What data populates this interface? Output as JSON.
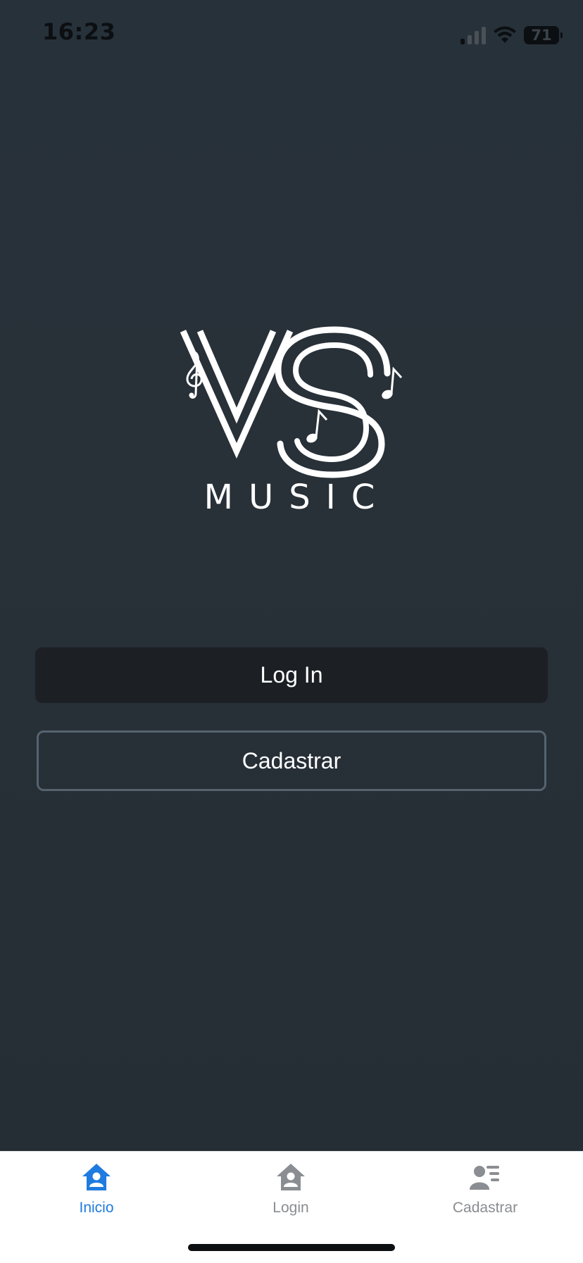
{
  "status_bar": {
    "time": "16:23",
    "battery": "71",
    "icons": [
      "cellular-signal-icon",
      "wifi-icon",
      "battery-icon"
    ]
  },
  "logo": {
    "monogram": "VS",
    "wordmark": "MUSIC"
  },
  "buttons": {
    "login_label": "Log In",
    "register_label": "Cadastrar"
  },
  "tabbar": {
    "tabs": [
      {
        "label": "Inicio",
        "icon": "home-person-icon",
        "active": true
      },
      {
        "label": "Login",
        "icon": "home-person-icon",
        "active": false
      },
      {
        "label": "Cadastrar",
        "icon": "contact-list-icon",
        "active": false
      }
    ]
  },
  "colors": {
    "background": "#262f36",
    "login_button": "#1c2025",
    "register_border": "#55636f",
    "tab_active": "#1f7be0",
    "tab_inactive": "#8a8d91"
  }
}
